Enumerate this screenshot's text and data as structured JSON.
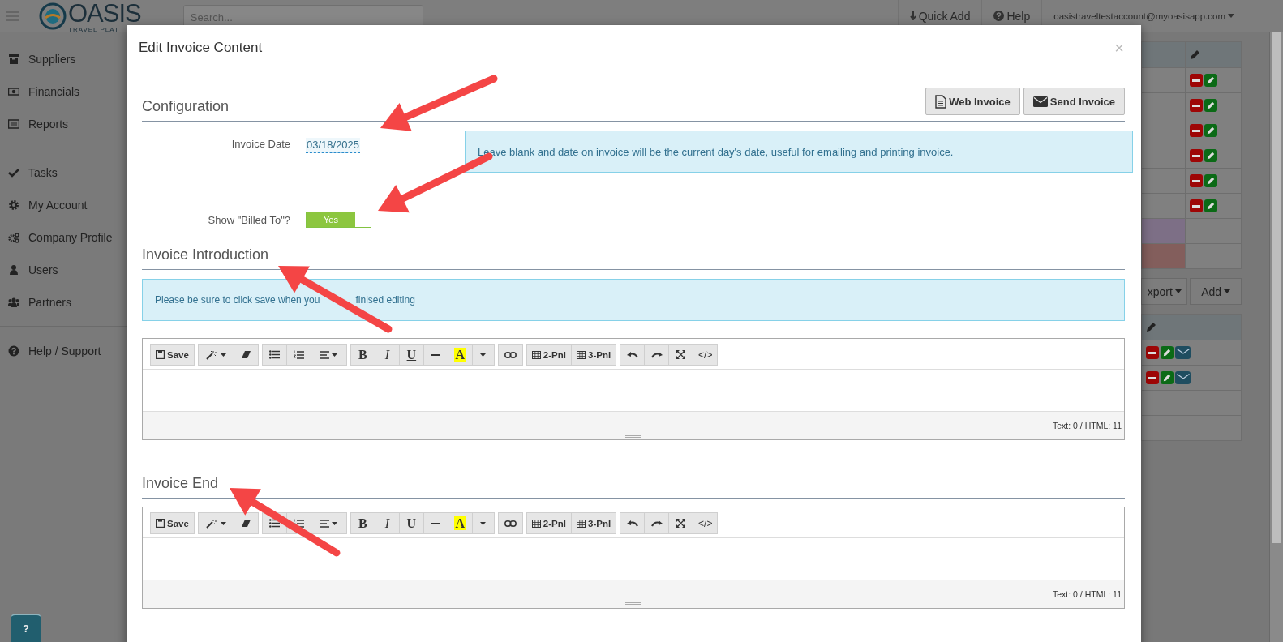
{
  "navbar": {
    "logo": "OASIS",
    "logo_tagline": "TRAVEL PLAT",
    "search": {
      "placeholder": "Search..."
    },
    "quick_add": "Quick Add",
    "help": "Help",
    "account": "oasistraveltestaccount@myoasisapp.com"
  },
  "sidebar": {
    "groups": [
      [
        {
          "label": "Suppliers"
        },
        {
          "label": "Financials"
        },
        {
          "label": "Reports"
        }
      ],
      [
        {
          "label": "Tasks"
        },
        {
          "label": "My Account"
        },
        {
          "label": "Company Profile"
        },
        {
          "label": "Users"
        },
        {
          "label": "Partners"
        }
      ],
      [
        {
          "label": "Help / Support"
        }
      ]
    ]
  },
  "background": {
    "table_1": {
      "rows": [
        {
          "kind": "actions"
        },
        {
          "kind": "actions"
        },
        {
          "kind": "actions"
        },
        {
          "kind": "actions"
        },
        {
          "kind": "actions"
        },
        {
          "kind": "actions"
        },
        {
          "kind": "highlight",
          "color": "#7d6f86"
        },
        {
          "kind": "highlight",
          "color": "#835e5c"
        }
      ]
    },
    "buttons": [
      "xport",
      "Add"
    ],
    "table_2": {
      "rows": [
        {
          "kind": "actions_mail"
        },
        {
          "kind": "actions_mail"
        },
        {
          "kind": "empty"
        },
        {
          "kind": "empty"
        }
      ]
    }
  },
  "modal": {
    "title": "Edit Invoice Content",
    "close": "×",
    "configuration": {
      "heading": "Configuration",
      "buttons": [
        {
          "kind": "document",
          "label": "Web Invoice"
        },
        {
          "kind": "mail",
          "label": "Send Invoice"
        }
      ],
      "invoice_date": {
        "label": "Invoice Date",
        "value": "03/18/2025"
      },
      "date_hint": "Leave blank and date on invoice will be the current day's date, useful for emailing and printing invoice.",
      "billed_to": {
        "label": "Show \"Billed To\"?",
        "on": true,
        "on_text": "Yes"
      }
    },
    "editors": [
      {
        "heading": "Invoice Introduction",
        "notice": "Please be sure to click save when you",
        "notice_continued": "finised editing",
        "status": "Text: 0 / HTML: 11",
        "toolbar": [
          [
            {
              "kind": "save",
              "label": "Save"
            }
          ],
          [
            {
              "kind": "magic"
            },
            {
              "kind": "eraser"
            }
          ],
          [
            {
              "kind": "ul"
            },
            {
              "kind": "ol"
            },
            {
              "kind": "align"
            }
          ],
          [
            {
              "kind": "bold",
              "label": "B"
            },
            {
              "kind": "italic",
              "label": "I"
            },
            {
              "kind": "underline",
              "label": "U"
            },
            {
              "kind": "hr"
            },
            {
              "kind": "color",
              "label": "A"
            },
            {
              "kind": "dropdown"
            }
          ],
          [
            {
              "kind": "link"
            }
          ],
          [
            {
              "kind": "table",
              "label": "2-Pnl"
            },
            {
              "kind": "table",
              "label": "3-Pnl"
            }
          ],
          [
            {
              "kind": "undo"
            },
            {
              "kind": "redo"
            },
            {
              "kind": "fullscreen"
            },
            {
              "kind": "code",
              "label": "</>"
            }
          ]
        ]
      },
      {
        "heading": "Invoice End",
        "status": "Text: 0 / HTML: 11",
        "toolbar": [
          [
            {
              "kind": "save",
              "label": "Save"
            }
          ],
          [
            {
              "kind": "magic"
            },
            {
              "kind": "eraser"
            }
          ],
          [
            {
              "kind": "ul"
            },
            {
              "kind": "ol"
            },
            {
              "kind": "align"
            }
          ],
          [
            {
              "kind": "bold",
              "label": "B"
            },
            {
              "kind": "italic",
              "label": "I"
            },
            {
              "kind": "underline",
              "label": "U"
            },
            {
              "kind": "hr"
            },
            {
              "kind": "color",
              "label": "A"
            },
            {
              "kind": "dropdown"
            }
          ],
          [
            {
              "kind": "link"
            }
          ],
          [
            {
              "kind": "table",
              "label": "2-Pnl"
            },
            {
              "kind": "table",
              "label": "3-Pnl"
            }
          ],
          [
            {
              "kind": "undo"
            },
            {
              "kind": "redo"
            },
            {
              "kind": "fullscreen"
            },
            {
              "kind": "code",
              "label": "</>"
            }
          ]
        ]
      }
    ]
  },
  "help_button": "?",
  "annotations": [
    {
      "kind": "arrow"
    },
    {
      "kind": "arrow"
    },
    {
      "kind": "arrow"
    },
    {
      "kind": "arrow"
    }
  ]
}
